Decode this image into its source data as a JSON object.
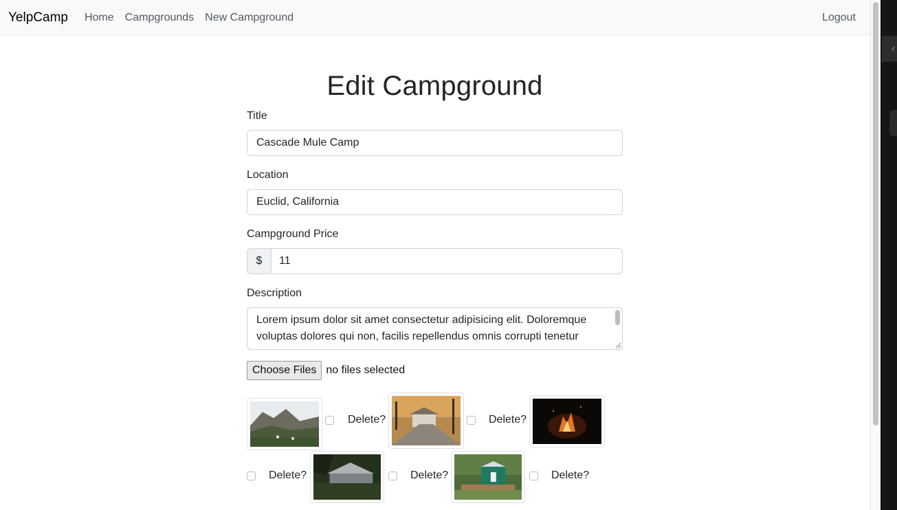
{
  "navbar": {
    "brand": "YelpCamp",
    "links": [
      "Home",
      "Campgrounds",
      "New Campground"
    ],
    "logout": "Logout"
  },
  "form": {
    "heading": "Edit Campground",
    "title_label": "Title",
    "title_value": "Cascade Mule Camp",
    "location_label": "Location",
    "location_value": "Euclid, California",
    "price_label": "Campground Price",
    "price_currency": "$",
    "price_value": "11",
    "description_label": "Description",
    "description_value": "Lorem ipsum dolor sit amet consectetur adipisicing elit. Doloremque voluptas dolores qui non, facilis repellendus omnis corrupti tenetur",
    "file_button": "Choose Files",
    "file_status": "no files selected",
    "delete_label": "Delete?",
    "images": [
      {
        "scene": "mountain-meadow",
        "checked": false
      },
      {
        "scene": "forest-cabin",
        "checked": false
      },
      {
        "scene": "campfire-night",
        "checked": false
      },
      {
        "scene": "forest-yurt",
        "checked": false
      },
      {
        "scene": "green-yurt",
        "checked": false
      }
    ]
  }
}
